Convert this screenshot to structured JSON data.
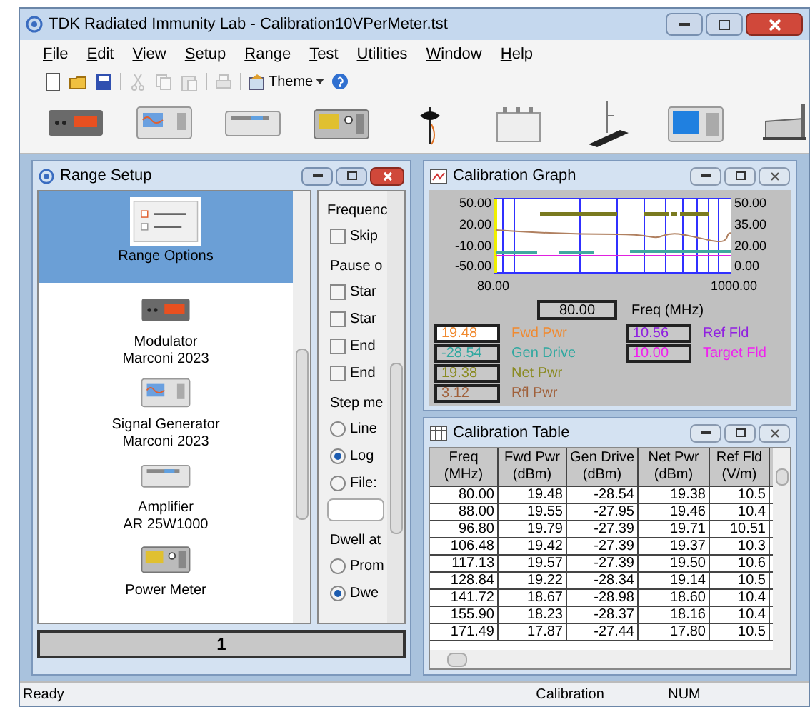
{
  "window": {
    "title": "TDK Radiated Immunity Lab - Calibration10VPerMeter.tst"
  },
  "menu": [
    {
      "label": "File"
    },
    {
      "label": "Edit"
    },
    {
      "label": "View"
    },
    {
      "label": "Setup"
    },
    {
      "label": "Range"
    },
    {
      "label": "Test"
    },
    {
      "label": "Utilities"
    },
    {
      "label": "Window"
    },
    {
      "label": "Help"
    }
  ],
  "toolbar": {
    "tools": [
      {
        "kind": "new",
        "disabled": false
      },
      {
        "kind": "open",
        "disabled": false
      },
      {
        "kind": "save",
        "disabled": false
      },
      {
        "kind": "cut",
        "disabled": true
      },
      {
        "kind": "copy",
        "disabled": true
      },
      {
        "kind": "paste",
        "disabled": true
      },
      {
        "kind": "print",
        "disabled": true
      }
    ],
    "theme_label": "Theme"
  },
  "instruments": [
    {
      "kind": "modulator"
    },
    {
      "kind": "generator"
    },
    {
      "kind": "amplifier"
    },
    {
      "kind": "meter"
    },
    {
      "kind": "probe"
    },
    {
      "kind": "box"
    },
    {
      "kind": "antenna"
    },
    {
      "kind": "monitor"
    },
    {
      "kind": "turntable"
    }
  ],
  "range_setup": {
    "title": "Range Setup",
    "items": [
      {
        "kind": "options",
        "label": "Range Options",
        "selected": true
      },
      {
        "kind": "modulator",
        "label": "Modulator",
        "sublabel": "Marconi 2023",
        "selected": false
      },
      {
        "kind": "generator",
        "label": "Signal Generator",
        "sublabel": "Marconi 2023",
        "selected": false
      },
      {
        "kind": "amplifier",
        "label": "Amplifier",
        "sublabel": "AR 25W1000",
        "selected": false
      },
      {
        "kind": "meter",
        "label": "Power Meter",
        "selected": false
      }
    ],
    "controls": [
      {
        "kind": "heading",
        "label": "Frequenc"
      },
      {
        "kind": "checkbox",
        "label": "Skip",
        "checked": false
      },
      {
        "kind": "group",
        "label": "Pause o"
      },
      {
        "kind": "checkbox",
        "label": "Star",
        "checked": false
      },
      {
        "kind": "checkbox",
        "label": "Star",
        "checked": false
      },
      {
        "kind": "checkbox",
        "label": "End",
        "checked": false
      },
      {
        "kind": "checkbox",
        "label": "End",
        "checked": false
      },
      {
        "kind": "group",
        "label": "Step me"
      },
      {
        "kind": "radio",
        "label": "Line",
        "selected": false
      },
      {
        "kind": "radio",
        "label": "Log",
        "selected": true
      },
      {
        "kind": "radio",
        "label": "File:",
        "selected": false
      },
      {
        "kind": "field"
      },
      {
        "kind": "group",
        "label": "Dwell at"
      },
      {
        "kind": "radio",
        "label": "Prom",
        "selected": false
      },
      {
        "kind": "radio",
        "label": "Dwe",
        "selected": true
      }
    ],
    "page": "1"
  },
  "graph": {
    "title": "Calibration Graph",
    "left_ticks": [
      "50.00",
      "20.00",
      "-10.00",
      "-50.00"
    ],
    "right_ticks": [
      "50.00",
      "35.00",
      "20.00",
      "0.00"
    ],
    "x_ticks": [
      "80.00",
      "1000.00"
    ],
    "freq_value": "80.00",
    "freq_label": "Freq (MHz)",
    "readouts_left": [
      {
        "value": "19.48",
        "label": "Fwd Pwr",
        "color": "#f08a30",
        "selected": true
      },
      {
        "value": "-28.54",
        "label": "Gen Drive",
        "color": "#30a8a0",
        "selected": false
      },
      {
        "value": "19.38",
        "label": "Net Pwr",
        "color": "#8a8a20",
        "selected": false
      },
      {
        "value": "3.12",
        "label": "Rfl Pwr",
        "color": "#a0603a",
        "selected": false
      }
    ],
    "readouts_right": [
      {
        "value": "10.56",
        "label": "Ref Fld",
        "color": "#9020e0",
        "selected": false
      },
      {
        "value": "10.00",
        "label": "Target Fld",
        "color": "#f020f0",
        "selected": false
      }
    ]
  },
  "table": {
    "title": "Calibration Table",
    "columns": [
      {
        "label": "Freq",
        "unit": "(MHz)"
      },
      {
        "label": "Fwd Pwr",
        "unit": "(dBm)"
      },
      {
        "label": "Gen Drive",
        "unit": "(dBm)"
      },
      {
        "label": "Net Pwr",
        "unit": "(dBm)"
      },
      {
        "label": "Ref Fld",
        "unit": "(V/m)"
      }
    ],
    "rows": [
      [
        "80.00",
        "19.48",
        "-28.54",
        "19.38",
        "10.5"
      ],
      [
        "88.00",
        "19.55",
        "-27.95",
        "19.46",
        "10.4"
      ],
      [
        "96.80",
        "19.79",
        "-27.39",
        "19.71",
        "10.51"
      ],
      [
        "106.48",
        "19.42",
        "-27.39",
        "19.37",
        "10.3"
      ],
      [
        "117.13",
        "19.57",
        "-27.39",
        "19.50",
        "10.6"
      ],
      [
        "128.84",
        "19.22",
        "-28.34",
        "19.14",
        "10.5"
      ],
      [
        "141.72",
        "18.67",
        "-28.98",
        "18.60",
        "10.4"
      ],
      [
        "155.90",
        "18.23",
        "-28.37",
        "18.16",
        "10.4"
      ],
      [
        "171.49",
        "17.87",
        "-27.44",
        "17.80",
        "10.5"
      ]
    ]
  },
  "status_bar": [
    "Ready",
    "Calibration",
    "NUM"
  ]
}
